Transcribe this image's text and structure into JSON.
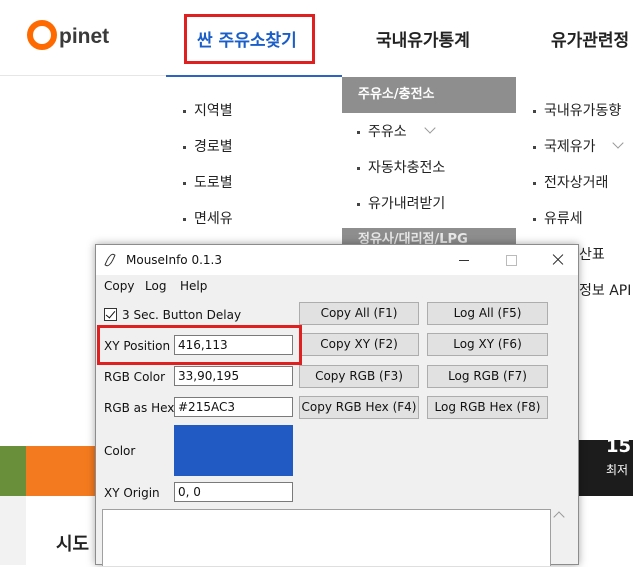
{
  "site": {
    "logo_o": "O",
    "logo_text": "pinet",
    "nav": [
      "싼 주유소찾기",
      "국내유가통계",
      "유가관련정"
    ],
    "menu_col1": [
      "지역별",
      "경로별",
      "도로별",
      "면세유"
    ],
    "menu_col2_head": "주유소/충전소",
    "menu_col2": [
      "주유소",
      "자동차충전소",
      "유가내려받기"
    ],
    "menu_col2_head2": "정유사/대리점/LPG",
    "menu_col3": [
      "국내유가동향",
      "국제유가",
      "전자상거래",
      "유류세"
    ],
    "side_partial": [
      "산표",
      "정보 API"
    ],
    "banner_num": "15",
    "banner_text": "최저",
    "sido": "시도"
  },
  "window": {
    "title": "MouseInfo 0.1.3",
    "menu": [
      "Copy",
      "Log",
      "Help"
    ],
    "checkbox_label": "3 Sec. Button Delay",
    "checkbox_checked": true,
    "xy_label": "XY Position",
    "xy_value": "416,113",
    "rgb_label": "RGB Color",
    "rgb_value": "33,90,195",
    "hex_label": "RGB as Hex",
    "hex_value": "#215AC3",
    "color_label": "Color",
    "color_swatch": "#215AC3",
    "origin_label": "XY Origin",
    "origin_value": "0, 0",
    "buttons": {
      "copy_all": "Copy All (F1)",
      "log_all": "Log All (F5)",
      "copy_xy": "Copy XY (F2)",
      "log_xy": "Log XY (F6)",
      "copy_rgb": "Copy RGB (F3)",
      "log_rgb": "Log RGB (F7)",
      "copy_hex": "Copy RGB Hex (F4)",
      "log_hex": "Log RGB Hex (F8)"
    }
  },
  "colors": {
    "brand_orange": "#ff6a00",
    "nav_blue": "#1a5ec8",
    "highlight_red": "#e02020"
  }
}
